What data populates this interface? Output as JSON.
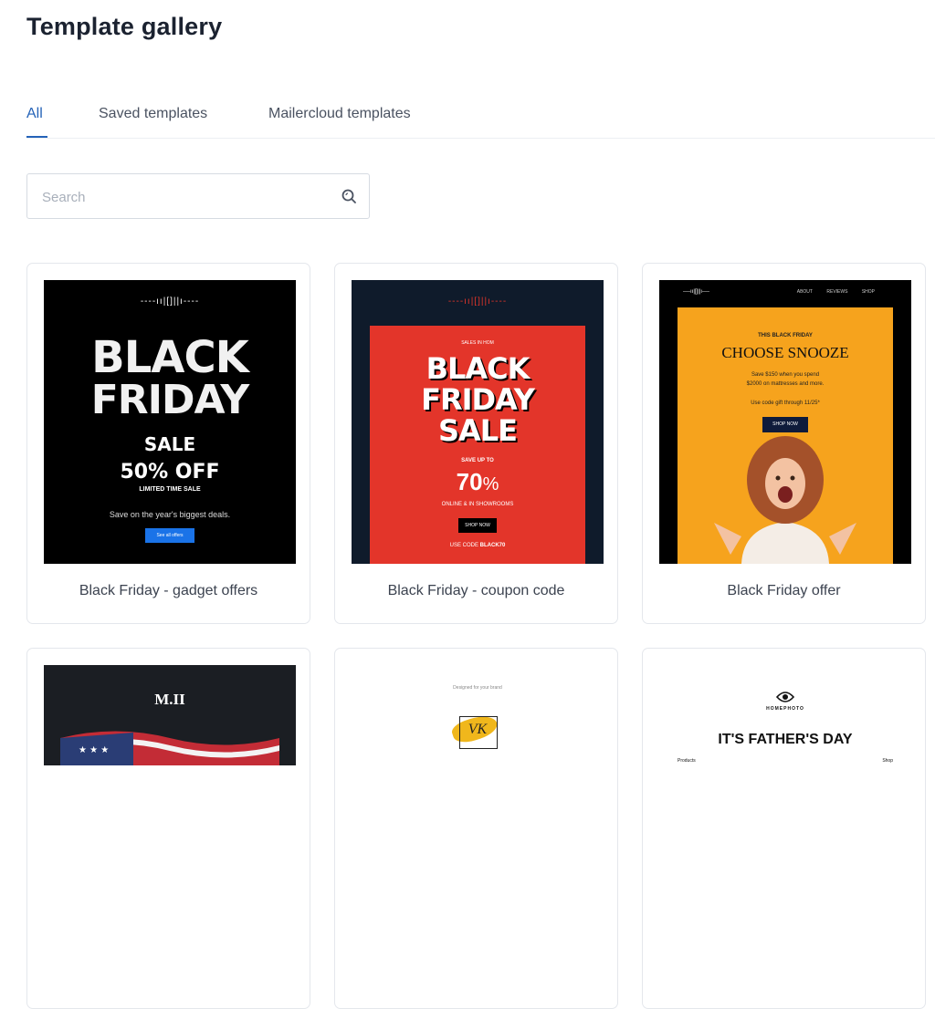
{
  "page": {
    "title": "Template gallery"
  },
  "tabs": [
    {
      "label": "All",
      "active": true
    },
    {
      "label": "Saved templates",
      "active": false
    },
    {
      "label": "Mailercloud templates",
      "active": false
    }
  ],
  "search": {
    "placeholder": "Search",
    "value": ""
  },
  "cards": [
    {
      "title": "Black Friday - gadget offers",
      "preview": {
        "logo": "----ıı|[]||ı----",
        "line1": "BLACK",
        "line2": "FRIDAY",
        "sale": "SALE",
        "offer": "50% OFF",
        "limited": "LIMITED TIME SALE",
        "tagline": "Save on the year's biggest deals.",
        "button": "See all offers"
      }
    },
    {
      "title": "Black Friday - coupon code",
      "preview": {
        "logo": "----ıı|[]||ı----",
        "eyebrow": "SALES IN HOM",
        "line1": "BLACK",
        "line2": "FRIDAY",
        "line3": "SALE",
        "save": "SAVE UP TO",
        "percent": "70",
        "percent_sign": "%",
        "where": "ONLINE & IN SHOWROOMS",
        "button": "SHOP NOW",
        "code_prefix": "USE CODE",
        "code": "BLACK70"
      }
    },
    {
      "title": "Black Friday offer",
      "preview": {
        "logo": "----ıı|[]||ı----",
        "nav": [
          "ABOUT",
          "REVIEWS",
          "SHOP"
        ],
        "eyebrow": "THIS BLACK FRIDAY",
        "headline": "CHOOSE SNOOZE",
        "body1": "Save $150 when you spend",
        "body2": "$2000 on mattresses and more.",
        "code_text": "Use code gift through 11/25*",
        "button": "SHOP NOW"
      }
    },
    {
      "title": "",
      "preview": {
        "logo": "M.II"
      }
    },
    {
      "title": "",
      "preview": {
        "eyebrow": "Designed for your brand",
        "monogram": "VK"
      }
    },
    {
      "title": "",
      "preview": {
        "brand": "HOMEPHOTO",
        "headline": "IT'S FATHER'S DAY",
        "left_label": "Products",
        "right_label": "Shop"
      }
    }
  ],
  "colors": {
    "accent": "#2563b8",
    "coupon_red": "#e3352a",
    "coupon_bg": "#0f1b2b",
    "offer_orange": "#f6a31d",
    "blue_button": "#1a73e8"
  }
}
